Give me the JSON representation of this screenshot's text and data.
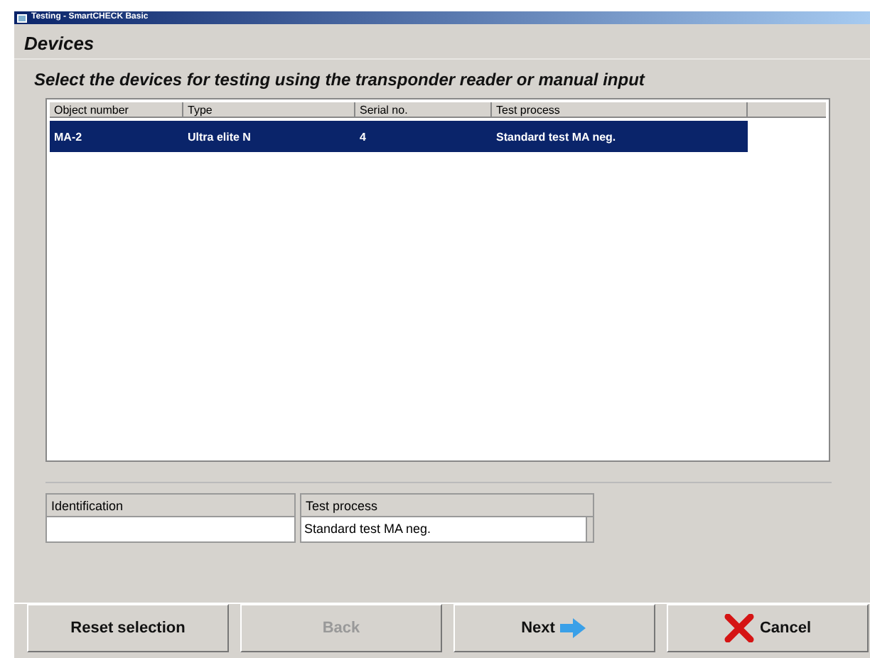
{
  "window": {
    "title": "Testing - SmartCHECK Basic"
  },
  "heading": "Devices",
  "instruction": "Select the devices for testing  using the transponder reader or manual input",
  "table": {
    "columns": [
      "Object number",
      "Type",
      "Serial no.",
      "Test process"
    ],
    "rows": [
      {
        "cells": [
          "MA-2",
          "Ultra elite N",
          "4",
          "Standard test MA neg."
        ],
        "selected": true
      }
    ]
  },
  "fields": [
    {
      "label": "Identification",
      "kind": "text"
    },
    {
      "label": "Test process",
      "kind": "dropdown",
      "value": "Standard test MA neg."
    }
  ],
  "buttons": [
    {
      "label": "Reset selection",
      "kind": "plain",
      "disabled": false
    },
    {
      "label": "Back",
      "kind": "plain",
      "disabled": true
    },
    {
      "label": "Next",
      "kind": "next",
      "disabled": false
    },
    {
      "label": "Cancel",
      "kind": "cancel",
      "disabled": false
    }
  ]
}
